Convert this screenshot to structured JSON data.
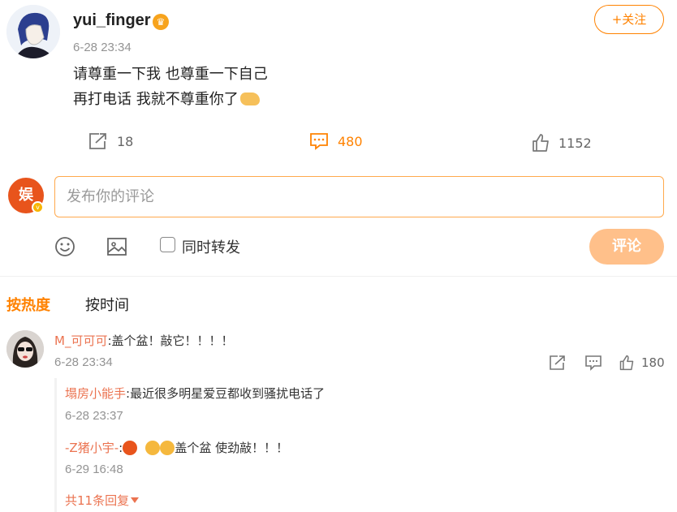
{
  "post": {
    "username": "yui_finger",
    "crown": "♛",
    "time": "6-28 23:34",
    "follow_label": "+关注",
    "line1": "请尊重一下我 也尊重一下自己",
    "line2": "再打电话 我就不尊重你了",
    "actions": {
      "repost_count": "18",
      "comment_count": "480",
      "like_count": "1152"
    }
  },
  "composer": {
    "avatar_text": "娱",
    "verified_badge": "v",
    "placeholder": "发布你的评论",
    "repost_label": "同时转发",
    "submit_label": "评论"
  },
  "sort_tabs": {
    "hot": "按热度",
    "time": "按时间"
  },
  "comments": [
    {
      "name": "M_可可可",
      "text": ":盖个盆！敲它！！！！",
      "time": "6-28 23:34",
      "like_count": "180",
      "replies": [
        {
          "name": "塌房小能手",
          "text": ":最近很多明星爱豆都收到骚扰电话了",
          "time": "6-28 23:37"
        },
        {
          "name": "-Z猪小宇-",
          "text_prefix": ":",
          "text": "盖个盆 使劲敲！！！",
          "time": "6-29 16:48"
        }
      ],
      "more_replies": "共11条回复"
    }
  ],
  "colors": {
    "accent": "#ff8200",
    "name": "#eb7350",
    "submit_disabled": "#ffc08a"
  },
  "icons": [
    "crown-icon",
    "repost-icon",
    "comment-icon",
    "like-icon",
    "emoji-icon",
    "image-icon",
    "share-icon",
    "chevron-down-icon"
  ]
}
